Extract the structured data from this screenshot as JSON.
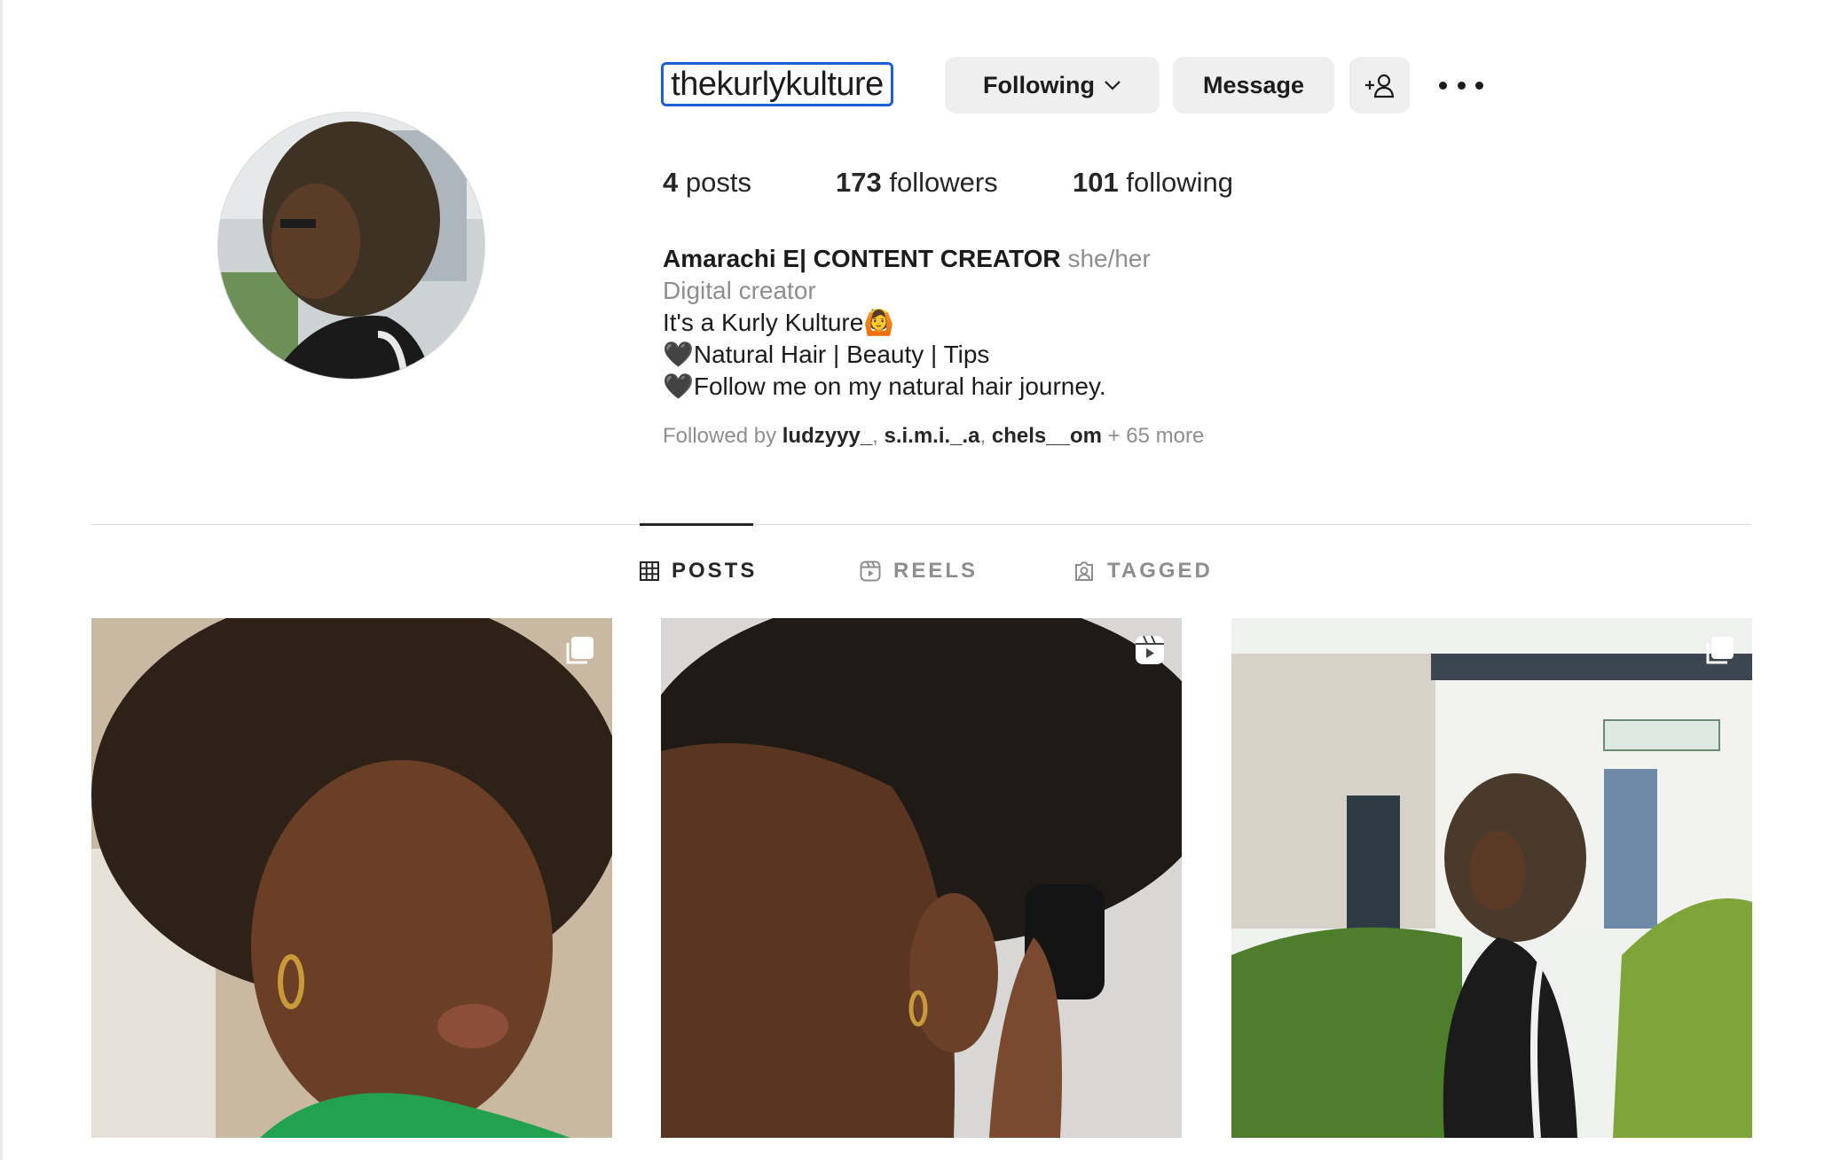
{
  "profile": {
    "username": "thekurlykulture",
    "buttons": {
      "following": "Following",
      "message": "Message"
    },
    "stats": {
      "posts_count": "4",
      "posts_label": "posts",
      "followers_count": "173",
      "followers_label": "followers",
      "following_count": "101",
      "following_label": "following"
    },
    "bio": {
      "name": "Amarachi E| CONTENT CREATOR",
      "pronouns": "she/her",
      "category": "Digital creator",
      "lines": [
        "It's a Kurly Kulture🙆",
        "🖤Natural Hair | Beauty | Tips",
        "🖤Follow me on my natural hair journey."
      ]
    },
    "followed_by": {
      "prefix": "Followed by",
      "users": [
        "ludzyyy_",
        "s.i.m.i._.a",
        "chels__om"
      ],
      "suffix": "+ 65 more"
    }
  },
  "tabs": [
    {
      "label": "POSTS",
      "icon": "grid-icon",
      "active": true
    },
    {
      "label": "REELS",
      "icon": "reels-icon",
      "active": false
    },
    {
      "label": "TAGGED",
      "icon": "tagged-icon",
      "active": false
    }
  ],
  "posts": [
    {
      "badge": "carousel-icon"
    },
    {
      "badge": "reel-icon"
    },
    {
      "badge": "carousel-icon"
    }
  ],
  "colors": {
    "focus_ring": "#1a5fd6",
    "button_bg": "#efefef",
    "muted_text": "#8e8e8e"
  }
}
